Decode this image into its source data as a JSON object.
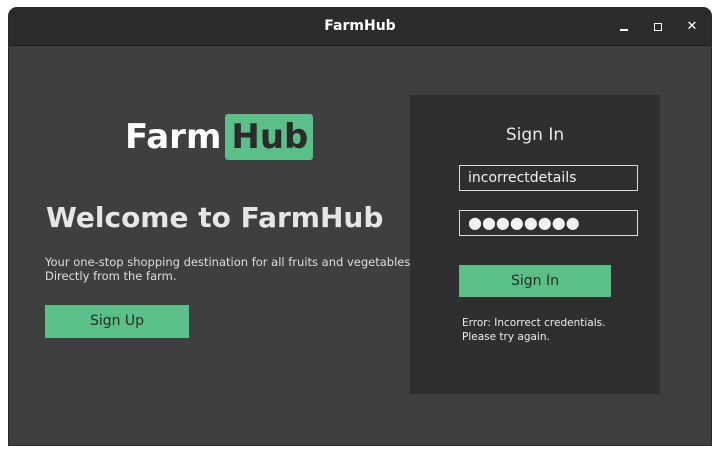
{
  "window": {
    "title": "FarmHub",
    "controls": {
      "minimize": "minimize-icon",
      "maximize": "maximize-icon",
      "close": "close-icon"
    }
  },
  "logo": {
    "part1": "Farm",
    "part2": "Hub"
  },
  "hero": {
    "heading": "Welcome to FarmHub",
    "tagline_line1": "Your one-stop shopping destination for all fruits and vegetables.",
    "tagline_line2": "Directly from the farm.",
    "signup_label": "Sign Up"
  },
  "signin": {
    "title": "Sign In",
    "username_value": "incorrectdetails",
    "password_value": "●●●●●●●●",
    "button_label": "Sign In",
    "error_line1": "Error: Incorrect credentials.",
    "error_line2": "Please try again."
  },
  "colors": {
    "accent": "#5bbf88",
    "background": "#3f3f3f",
    "panel": "#2f2f2f",
    "titlebar": "#2c2c2c"
  }
}
